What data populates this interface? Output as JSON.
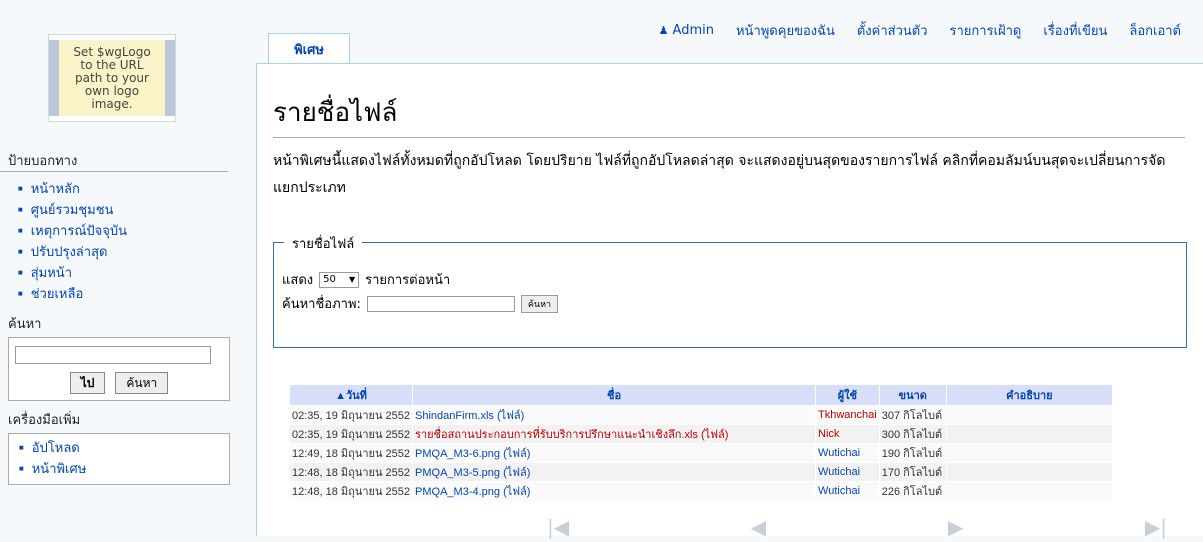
{
  "personal": {
    "user": "Admin",
    "talk": "หน้าพูดคุยของฉัน",
    "preferences": "ตั้งค่าส่วนตัว",
    "watchlist": "รายการเฝ้าดู",
    "contributions": "เรื่องที่เขียน",
    "logout": "ล็อกเอาต์"
  },
  "logo": {
    "text": "Set $wgLogo\nto the URL\npath to your\nown logo\nimage."
  },
  "tab": {
    "label": "พิเศษ"
  },
  "page": {
    "title": "รายชื่อไฟล์",
    "intro": "หน้าพิเศษนี้แสดงไฟล์ทั้งหมดที่ถูกอัปโหลด โดยปริยาย ไฟล์ที่ถูกอัปโหลดล่าสุด จะแสดงอยู่บนสุดของรายการไฟล์ คลิกที่คอมลัมน์บนสุดจะเปลี่ยนการจัดแยกประเภท"
  },
  "form": {
    "legend": "รายชื่อไฟล์",
    "show_label": "แสดง",
    "limit_value": "50",
    "per_page_label": "รายการต่อหน้า",
    "search_label": "ค้นหาชื่อภาพ:",
    "search_value": "",
    "search_button": "ค้นหา"
  },
  "table": {
    "headers": [
      "▲วันที่",
      "ชื่อ",
      "ผู้ใช้",
      "ขนาด",
      "คำอธิบาย"
    ],
    "rows": [
      [
        "02:35, 19 มิถุนายน 2552",
        "ShindanFirm.xls (ไฟล์)",
        "Tkhwanchai",
        "307 กิโลไบต์",
        ""
      ],
      [
        "02:35, 19 มิถุนายน 2552",
        "รายชื่อสถานประกอบการที่รับบริการปรึกษาแนะนำเชิงลึก.xls (ไฟล์)",
        "Nick",
        "300 กิโลไบต์",
        ""
      ],
      [
        "12:49, 18 มิถุนายน 2552",
        "PMQA_M3-6.png (ไฟล์)",
        "Wutichai",
        "190 กิโลไบต์",
        ""
      ],
      [
        "12:48, 18 มิถุนายน 2552",
        "PMQA_M3-5.png (ไฟล์)",
        "Wutichai",
        "170 กิโลไบต์",
        ""
      ],
      [
        "12:48, 18 มิถุนายน 2552",
        "PMQA_M3-4.png (ไฟล์)",
        "Wutichai",
        "226 กิโลไบต์",
        ""
      ]
    ]
  },
  "pager": [
    "first-icon",
    "prev-icon",
    "next-icon",
    "last-icon"
  ],
  "sidebar": {
    "nav_title": "ป้ายบอกทาง",
    "nav_items": [
      "หน้าหลัก",
      "ศูนย์รวมชุมชน",
      "เหตุการณ์ปัจจุบัน",
      "ปรับปรุงล่าสุด",
      "สุ่มหน้า",
      "ช่วยเหลือ"
    ],
    "search_title": "ค้นหา",
    "go_button": "ไป",
    "search_button": "ค้นหา",
    "toolbox_title": "เครื่องมือเพิ่ม",
    "toolbox_items": [
      "อัปโหลด",
      "หน้าพิเศษ"
    ]
  },
  "colors": {
    "link": "#0645ad",
    "red_link": "#ba0000",
    "border": "#aacfe6"
  }
}
